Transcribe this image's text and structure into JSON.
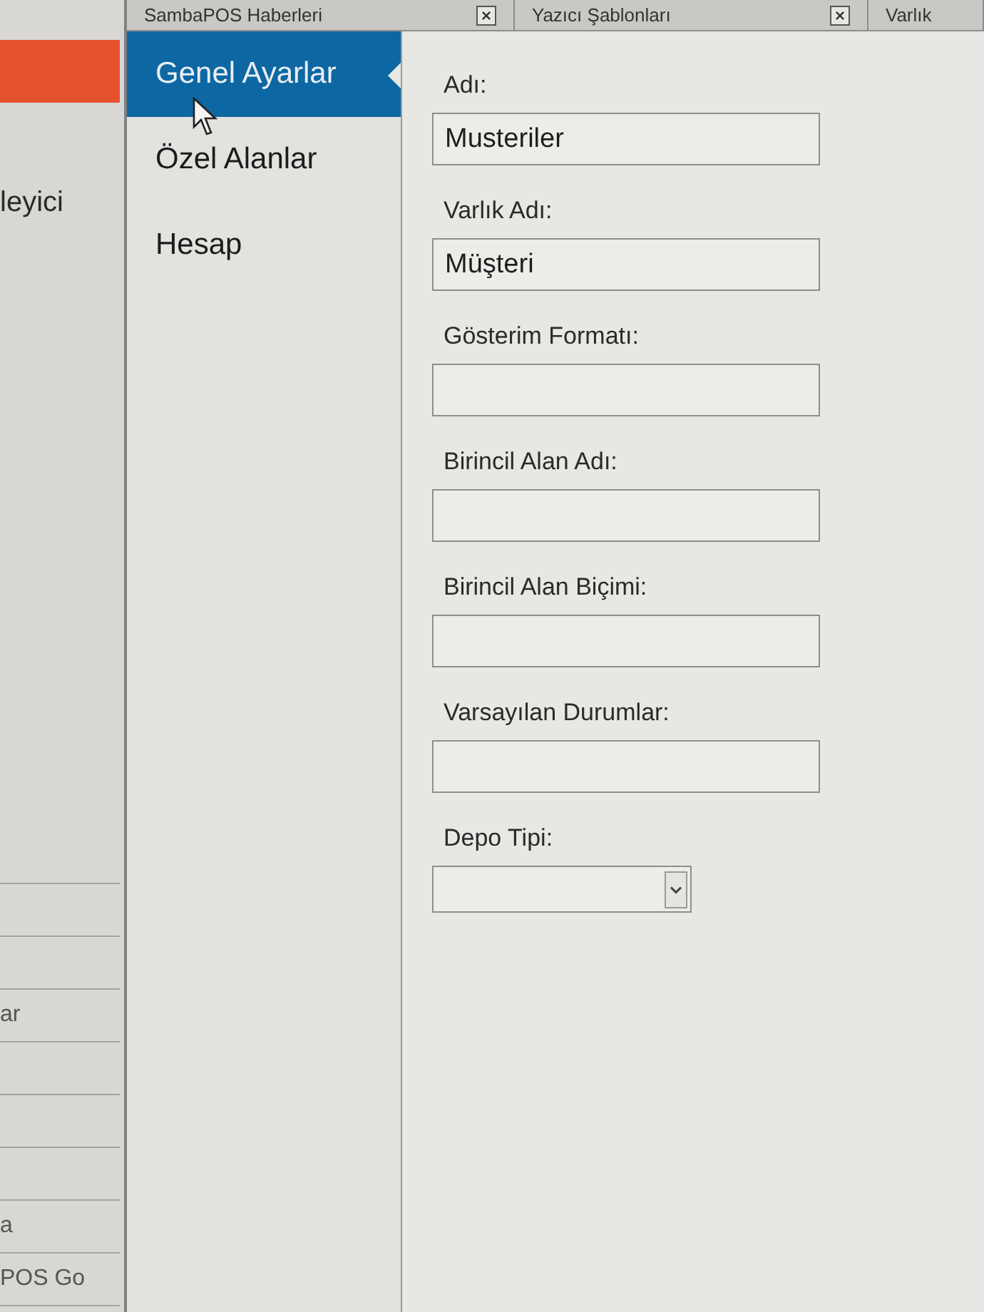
{
  "tabs": [
    {
      "label": "SambaPOS Haberleri"
    },
    {
      "label": "Yazıcı Şablonları"
    },
    {
      "label": "Varlık"
    }
  ],
  "left_panel": {
    "title": "leyici",
    "rows": [
      {
        "kind": "empty"
      },
      {
        "kind": "empty"
      },
      {
        "kind": "text",
        "label": "ar"
      },
      {
        "kind": "empty"
      },
      {
        "kind": "empty"
      },
      {
        "kind": "empty"
      },
      {
        "kind": "text",
        "label": "a"
      },
      {
        "kind": "text",
        "label": "POS Go"
      }
    ]
  },
  "nav": {
    "items": [
      {
        "label": "Genel Ayarlar",
        "selected": true
      },
      {
        "label": "Özel Alanlar",
        "selected": false
      },
      {
        "label": "Hesap",
        "selected": false
      }
    ]
  },
  "form": {
    "fields": [
      {
        "label": "Adı:",
        "kind": "text",
        "value": "Musteriler"
      },
      {
        "label": "Varlık Adı:",
        "kind": "text",
        "value": "Müşteri"
      },
      {
        "label": "Gösterim Formatı:",
        "kind": "text"
      },
      {
        "label": "Birincil Alan Adı:",
        "kind": "text"
      },
      {
        "label": "Birincil Alan Biçimi:",
        "kind": "text"
      },
      {
        "label": "Varsayılan Durumlar:",
        "kind": "text"
      },
      {
        "label": "Depo Tipi:",
        "kind": "select"
      }
    ]
  }
}
